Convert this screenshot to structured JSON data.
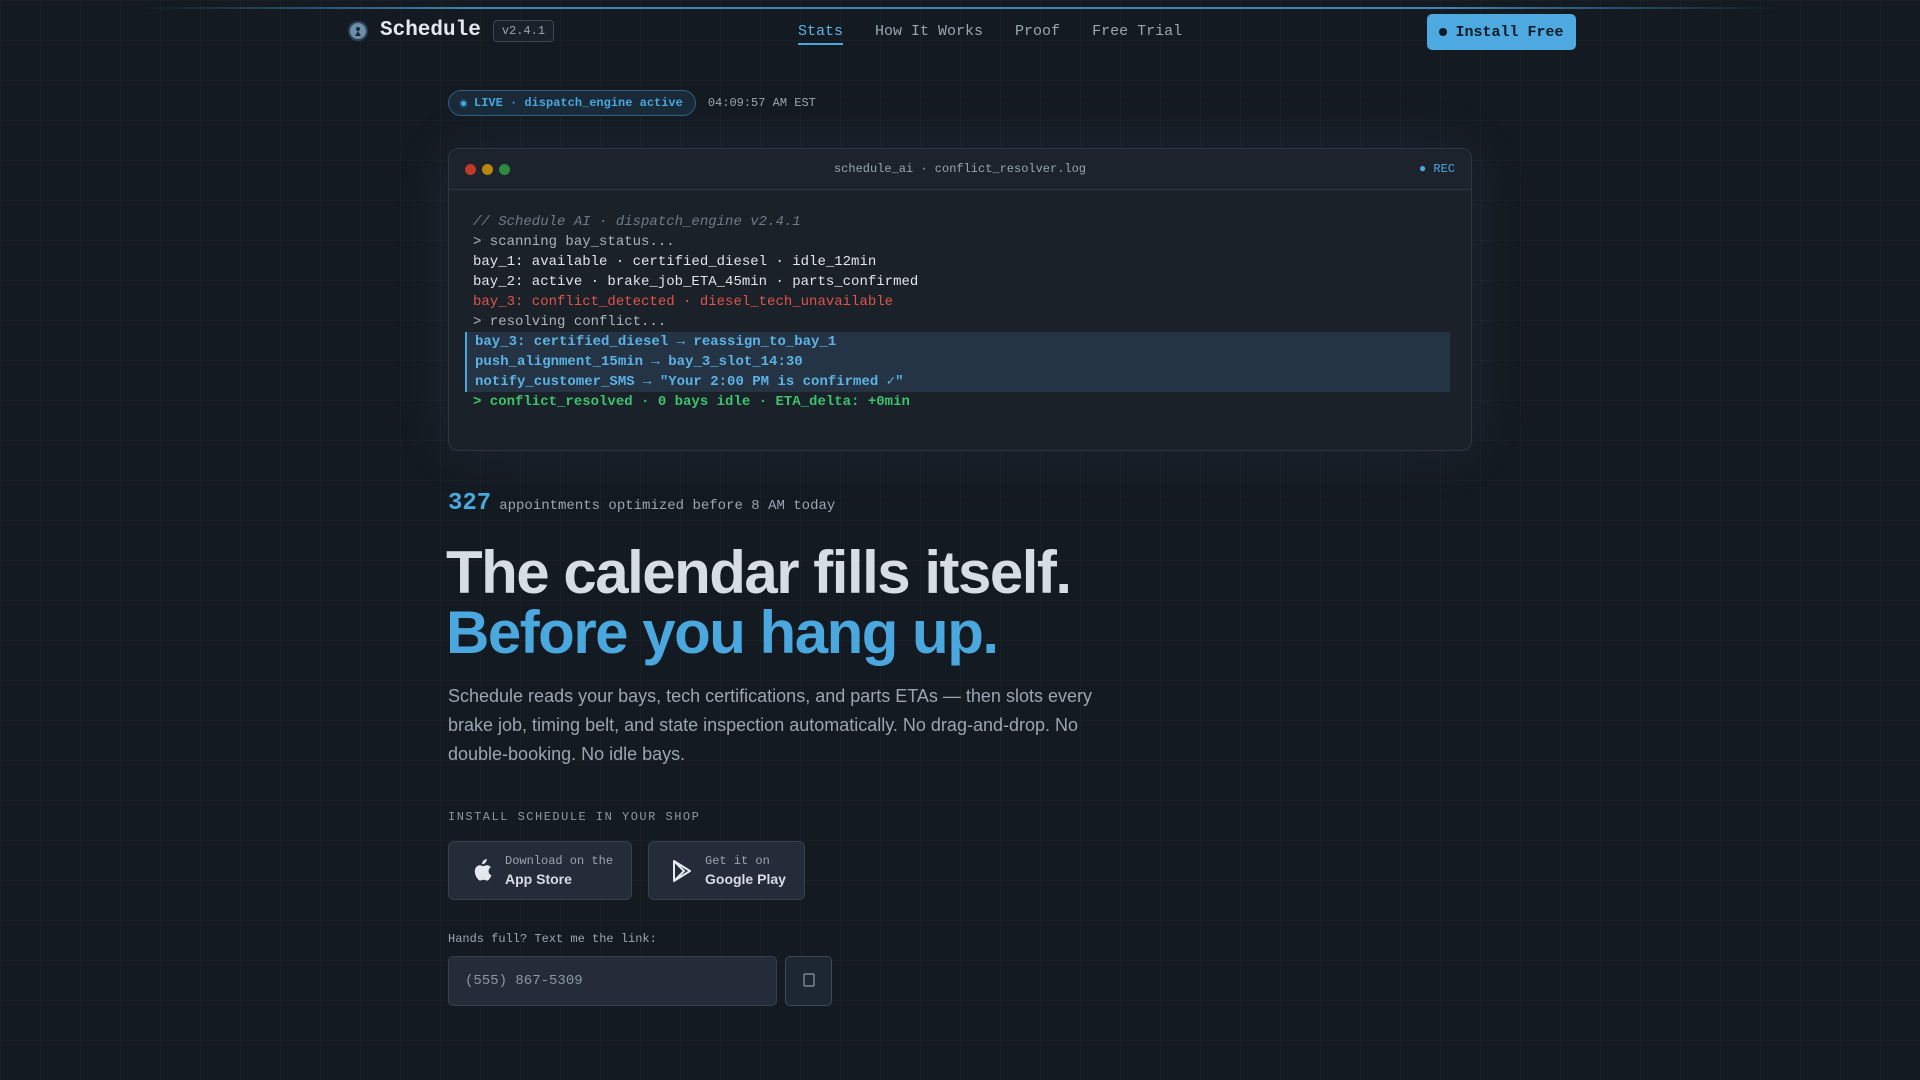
{
  "nav": {
    "brand": "Schedule",
    "version": "v2.4.1",
    "links": [
      "Stats",
      "How It Works",
      "Proof",
      "Free Trial"
    ],
    "active_link": "Stats",
    "install_label": "Install Free"
  },
  "live": {
    "label": "LIVE · dispatch_engine active",
    "time": "04:09:57 AM EST"
  },
  "terminal": {
    "title": "schedule_ai · conflict_resolver.log",
    "rec": "● REC",
    "lines": {
      "comment": "// Schedule AI · dispatch_engine v2.4.1",
      "scan": "> scanning bay_status...",
      "bay1": "bay_1: available · certified_diesel · idle_12min",
      "bay2": "bay_2: active · brake_job_ETA_45min · parts_confirmed",
      "bay3": "bay_3: conflict_detected · diesel_tech_unavailable",
      "resolving": "> resolving conflict...",
      "fix1": "bay_3: certified_diesel → reassign_to_bay_1",
      "fix2": "push_alignment_15min → bay_3_slot_14:30",
      "fix3": "notify_customer_SMS → \"Your 2:00 PM is confirmed ✓\"",
      "resolved": "> conflict_resolved · 0 bays idle · ETA_delta: +0min"
    }
  },
  "stat": {
    "number": "327",
    "label": "appointments optimized before 8 AM today"
  },
  "hero": {
    "headline": "The calendar fills itself.",
    "headline_accent": "Before you hang up.",
    "paragraph": "Schedule reads your bays, tech certifications, and parts ETAs — then slots every brake job, timing belt, and state inspection automatically. No drag-and-drop. No double-booking. No idle bays."
  },
  "install": {
    "label": "INSTALL SCHEDULE IN YOUR SHOP",
    "app_store_small": "Download on the",
    "app_store_big": "App Store",
    "google_play_small": "Get it on",
    "google_play_big": "Google Play"
  },
  "sms": {
    "label": "Hands full? Text me the link:",
    "placeholder": "(555) 867-5309"
  },
  "colors": {
    "accent": "#4aa8de",
    "background": "#141a21",
    "error": "#e0534a",
    "success": "#3cc36b"
  },
  "icons": [
    "logo-icon",
    "apple-icon",
    "google-play-icon",
    "send-icon"
  ]
}
